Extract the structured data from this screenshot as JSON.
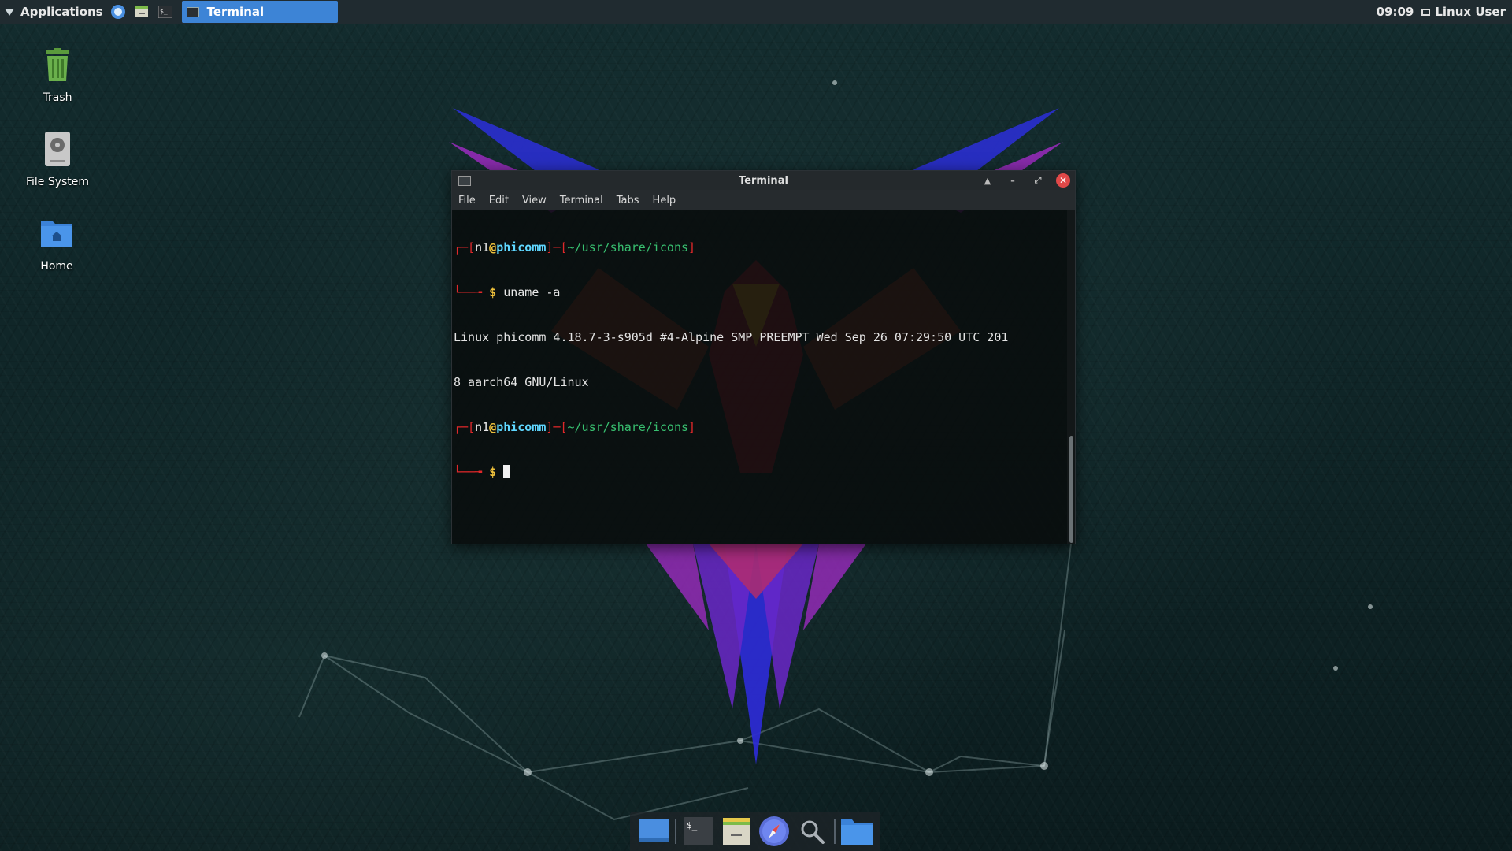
{
  "top_panel": {
    "applications_label": "Applications",
    "task_title": "Terminal",
    "clock": "09:09",
    "user": "Linux User"
  },
  "desktop_icons": [
    {
      "label": "Trash",
      "icon": "trash-icon"
    },
    {
      "label": "File System",
      "icon": "drive-icon"
    },
    {
      "label": "Home",
      "icon": "home-folder-icon"
    }
  ],
  "terminal": {
    "title": "Terminal",
    "menu": [
      "File",
      "Edit",
      "View",
      "Terminal",
      "Tabs",
      "Help"
    ],
    "prompt1": {
      "open_bracket": "┌─[",
      "user": "n1",
      "at": "@",
      "host": "phicomm",
      "sep": "]─[",
      "path": "~/usr/share/icons",
      "close_bracket": "]",
      "arrow": "└──╼ ",
      "dollar": "$",
      "command": " uname -a"
    },
    "output": [
      "Linux phicomm 4.18.7-3-s905d #4-Alpine SMP PREEMPT Wed Sep 26 07:29:50 UTC 201",
      "8 aarch64 GNU/Linux"
    ],
    "prompt2": {
      "open_bracket": "┌─[",
      "user": "n1",
      "at": "@",
      "host": "phicomm",
      "sep": "]─[",
      "path": "~/usr/share/icons",
      "close_bracket": "]",
      "arrow": "└──╼ ",
      "dollar": "$"
    }
  },
  "dock": [
    "desktop-icon",
    "terminal-icon",
    "file-manager-icon",
    "web-browser-icon",
    "search-icon",
    "folder-icon"
  ],
  "colors": {
    "panel": "#202b30",
    "task_active": "#3d84d6",
    "prompt_red": "#e0282a",
    "prompt_cyan": "#5fd7ff",
    "path_green": "#38c070",
    "dollar_yellow": "#f0c23c"
  }
}
